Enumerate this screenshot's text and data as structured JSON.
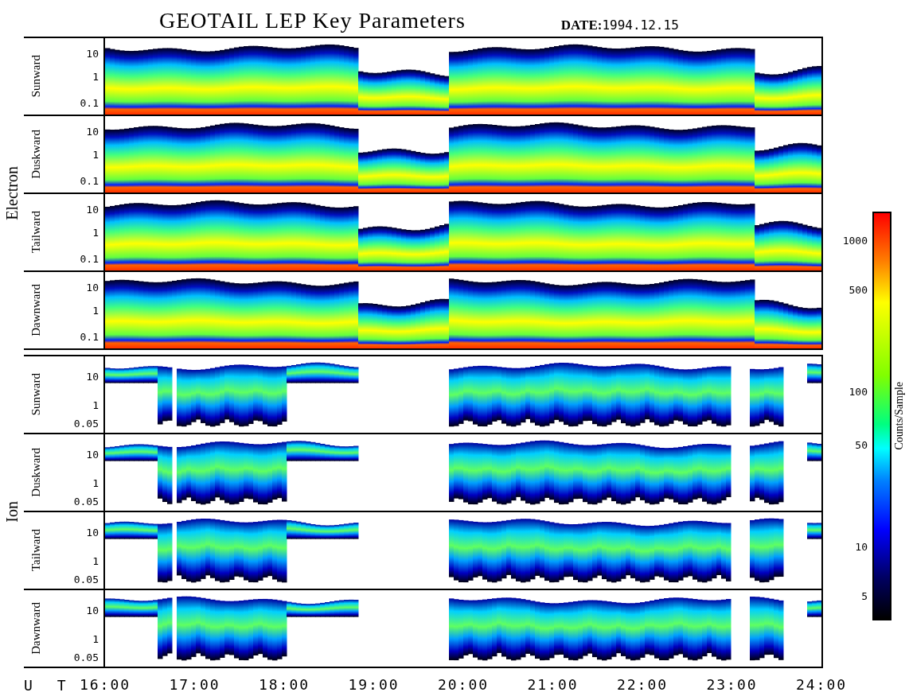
{
  "title": "GEOTAIL LEP Key Parameters",
  "date": {
    "label": "DATE:",
    "value": "1994.12.15"
  },
  "groups": [
    {
      "name": "Electron",
      "kind": "electron",
      "panels": [
        {
          "label": "Sunward",
          "yticks": [
            "10",
            "1",
            "0.1"
          ]
        },
        {
          "label": "Duskward",
          "yticks": [
            "10",
            "1",
            "0.1"
          ]
        },
        {
          "label": "Tailward",
          "yticks": [
            "10",
            "1",
            "0.1"
          ]
        },
        {
          "label": "Dawnward",
          "yticks": [
            "10",
            "1",
            "0.1"
          ]
        }
      ]
    },
    {
      "name": "Ion",
      "kind": "ion",
      "panels": [
        {
          "label": "Sunward",
          "yticks": [
            "10",
            "1",
            "0.05"
          ]
        },
        {
          "label": "Duskward",
          "yticks": [
            "10",
            "1",
            "0.05"
          ]
        },
        {
          "label": "Tailward",
          "yticks": [
            "10",
            "1",
            "0.05"
          ]
        },
        {
          "label": "Dawnward",
          "yticks": [
            "10",
            "1",
            "0.05"
          ]
        }
      ]
    }
  ],
  "x_axis": {
    "label": "U T",
    "ticks": [
      "16:00",
      "17:00",
      "18:00",
      "19:00",
      "20:00",
      "21:00",
      "22:00",
      "23:00",
      "24:00"
    ]
  },
  "colorbar": {
    "label": "Counts/Sample",
    "ticks": [
      "1000",
      "500",
      "100",
      "50",
      "10",
      "5"
    ]
  }
}
